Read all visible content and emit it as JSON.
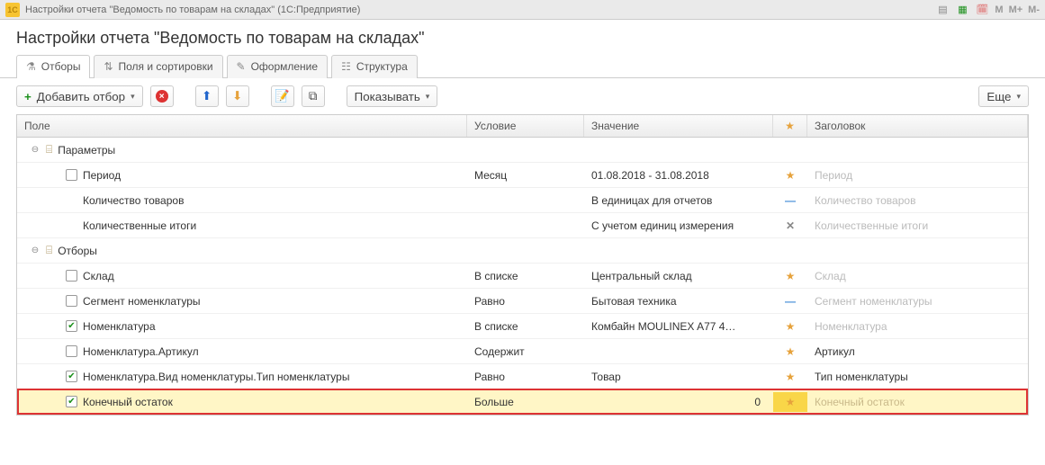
{
  "titlebar": {
    "logo": "1C",
    "title": "Настройки отчета \"Ведомость по товарам на складах\"  (1С:Предприятие)",
    "m": [
      "M",
      "M+",
      "M-"
    ]
  },
  "page_title": "Настройки отчета \"Ведомость по товарам на складах\"",
  "tabs": {
    "filters": "Отборы",
    "fields": "Поля и сортировки",
    "format": "Оформление",
    "structure": "Структура"
  },
  "toolbar": {
    "add_filter": "Добавить отбор",
    "show": "Показывать",
    "more": "Еще"
  },
  "columns": {
    "field": "Поле",
    "condition": "Условие",
    "value": "Значение",
    "star": "★",
    "header": "Заголовок"
  },
  "groups": {
    "params": "Параметры",
    "filters": "Отборы"
  },
  "rows": {
    "period": {
      "field": "Период",
      "cond": "Месяц",
      "value": "01.08.2018 - 31.08.2018",
      "head": "Период"
    },
    "qty": {
      "field": "Количество товаров",
      "cond": "",
      "value": "В единицах для отчетов",
      "head": "Количество товаров"
    },
    "qtotals": {
      "field": "Количественные итоги",
      "cond": "",
      "value": "С учетом единиц измерения",
      "head": "Количественные итоги"
    },
    "sklad": {
      "field": "Склад",
      "cond": "В списке",
      "value": "Центральный склад",
      "head": "Склад"
    },
    "segment": {
      "field": "Сегмент номенклатуры",
      "cond": "Равно",
      "value": "Бытовая техника",
      "head": "Сегмент номенклатуры"
    },
    "nomen": {
      "field": "Номенклатура",
      "cond": "В списке",
      "value": "Комбайн MOULINEX  A77 4…",
      "head": "Номенклатура"
    },
    "artikul": {
      "field": "Номенклатура.Артикул",
      "cond": "Содержит",
      "value": "",
      "head": "Артикул"
    },
    "type": {
      "field": "Номенклатура.Вид номенклатуры.Тип номенклатуры",
      "cond": "Равно",
      "value": "Товар",
      "head": "Тип номенклатуры"
    },
    "final": {
      "field": "Конечный остаток",
      "cond": "Больше",
      "value": "0",
      "head": "Конечный остаток"
    }
  }
}
